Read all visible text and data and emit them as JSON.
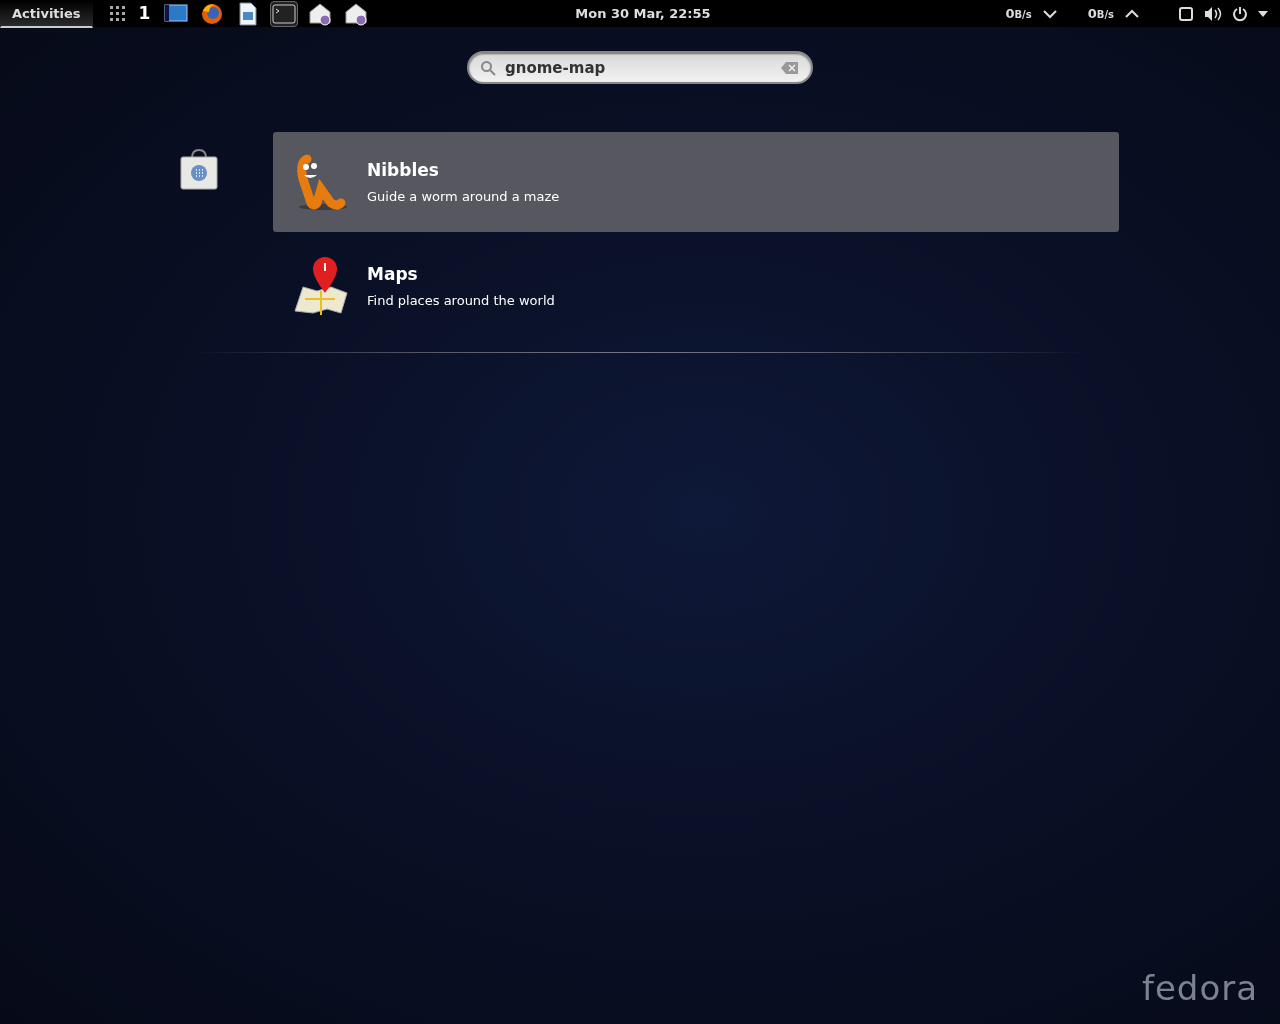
{
  "top_bar": {
    "activities": {
      "label": "Activities",
      "selected": true
    },
    "workspace": "1",
    "taskbar": [
      {
        "kind": "window",
        "selected": false
      },
      {
        "kind": "browser",
        "selected": false
      },
      {
        "kind": "document",
        "selected": false
      },
      {
        "kind": "terminal",
        "selected": true
      },
      {
        "kind": "mail",
        "selected": false
      },
      {
        "kind": "mail",
        "selected": false
      }
    ],
    "clock": "Mon 30 Mar, 22:55",
    "net": [
      {
        "value": "0",
        "unit": "B/s",
        "kind": "down"
      },
      {
        "value": "0",
        "unit": "B/s",
        "kind": "up"
      }
    ]
  },
  "search": {
    "value": "gnome-map"
  },
  "results": [
    {
      "kind": "worm",
      "name": "Nibbles",
      "description": "Guide a worm around a maze",
      "selected": true
    },
    {
      "kind": "map",
      "name": "Maps",
      "description": "Find places around the world",
      "selected": false
    }
  ],
  "wallpaper_logo": "fedora"
}
